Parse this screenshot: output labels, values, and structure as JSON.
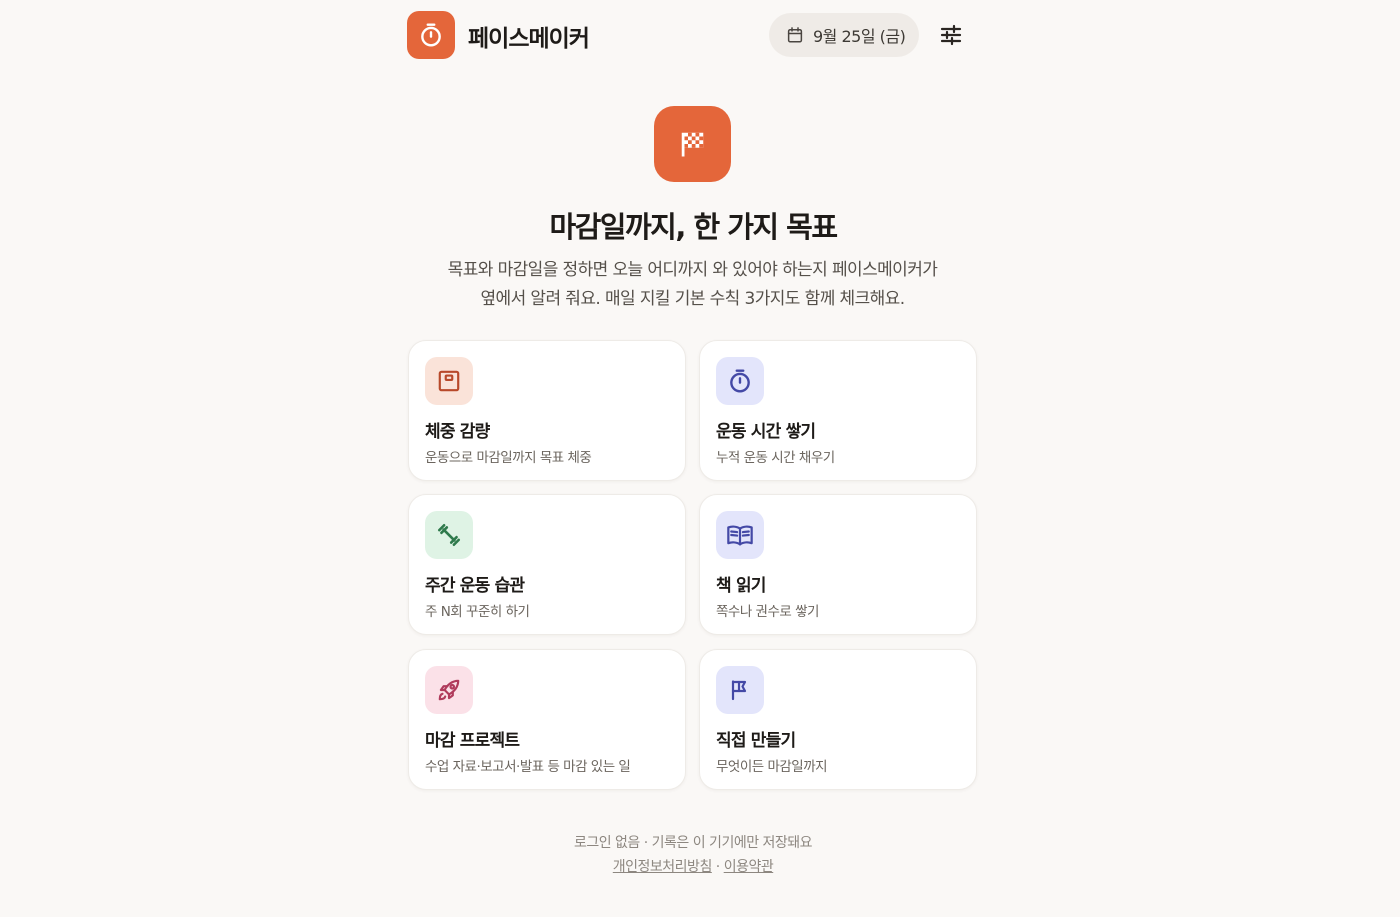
{
  "header": {
    "app_name": "페이스메이커",
    "logo_icon": "stopwatch-icon",
    "date_icon": "calendar-icon",
    "date_label": "9월 25일 (금)",
    "settings_icon": "sliders-icon"
  },
  "hero": {
    "icon": "checkered-flag-icon",
    "title": "마감일까지, 한 가지 목표",
    "description_line1": "목표와 마감일을 정하면 오늘 어디까지 와 있어야 하는지 페이스메이커가",
    "description_line2": "옆에서 알려 줘요. 매일 지킬 기본 수칙 3가지도 함께 체크해요."
  },
  "goals": [
    {
      "title": "체중 감량",
      "subtitle": "운동으로 마감일까지 목표 체중",
      "icon": "scale-icon"
    },
    {
      "title": "운동 시간 쌓기",
      "subtitle": "누적 운동 시간 채우기",
      "icon": "timer-icon"
    },
    {
      "title": "주간 운동 습관",
      "subtitle": "주 N회 꾸준히 하기",
      "icon": "dumbbell-icon"
    },
    {
      "title": "책 읽기",
      "subtitle": "쪽수나 권수로 쌓기",
      "icon": "book-icon"
    },
    {
      "title": "마감 프로젝트",
      "subtitle": "수업 자료·보고서·발표 등 마감 있는 일",
      "icon": "rocket-icon"
    },
    {
      "title": "직접 만들기",
      "subtitle": "무엇이든 마감일까지",
      "icon": "flag-icon"
    }
  ],
  "colors": {
    "accent": "#e4663a",
    "background": "#faf8f6",
    "scale_bg": "#fae3d9",
    "scale_fg": "#b8492a",
    "timer_bg": "#e3e5fb",
    "timer_fg": "#4449a6",
    "dumbbell_bg": "#dff3e5",
    "dumbbell_fg": "#2f7a4c",
    "book_bg": "#e3e5fb",
    "book_fg": "#4449a6",
    "rocket_bg": "#fbe1e8",
    "rocket_fg": "#b03b5c",
    "flag_bg": "#e3e5fb",
    "flag_fg": "#4449a6"
  },
  "footer": {
    "note": "로그인 없음 · 기록은 이 기기에만 저장돼요",
    "privacy_link": "개인정보처리방침",
    "separator": " · ",
    "terms_link": "이용약관"
  }
}
